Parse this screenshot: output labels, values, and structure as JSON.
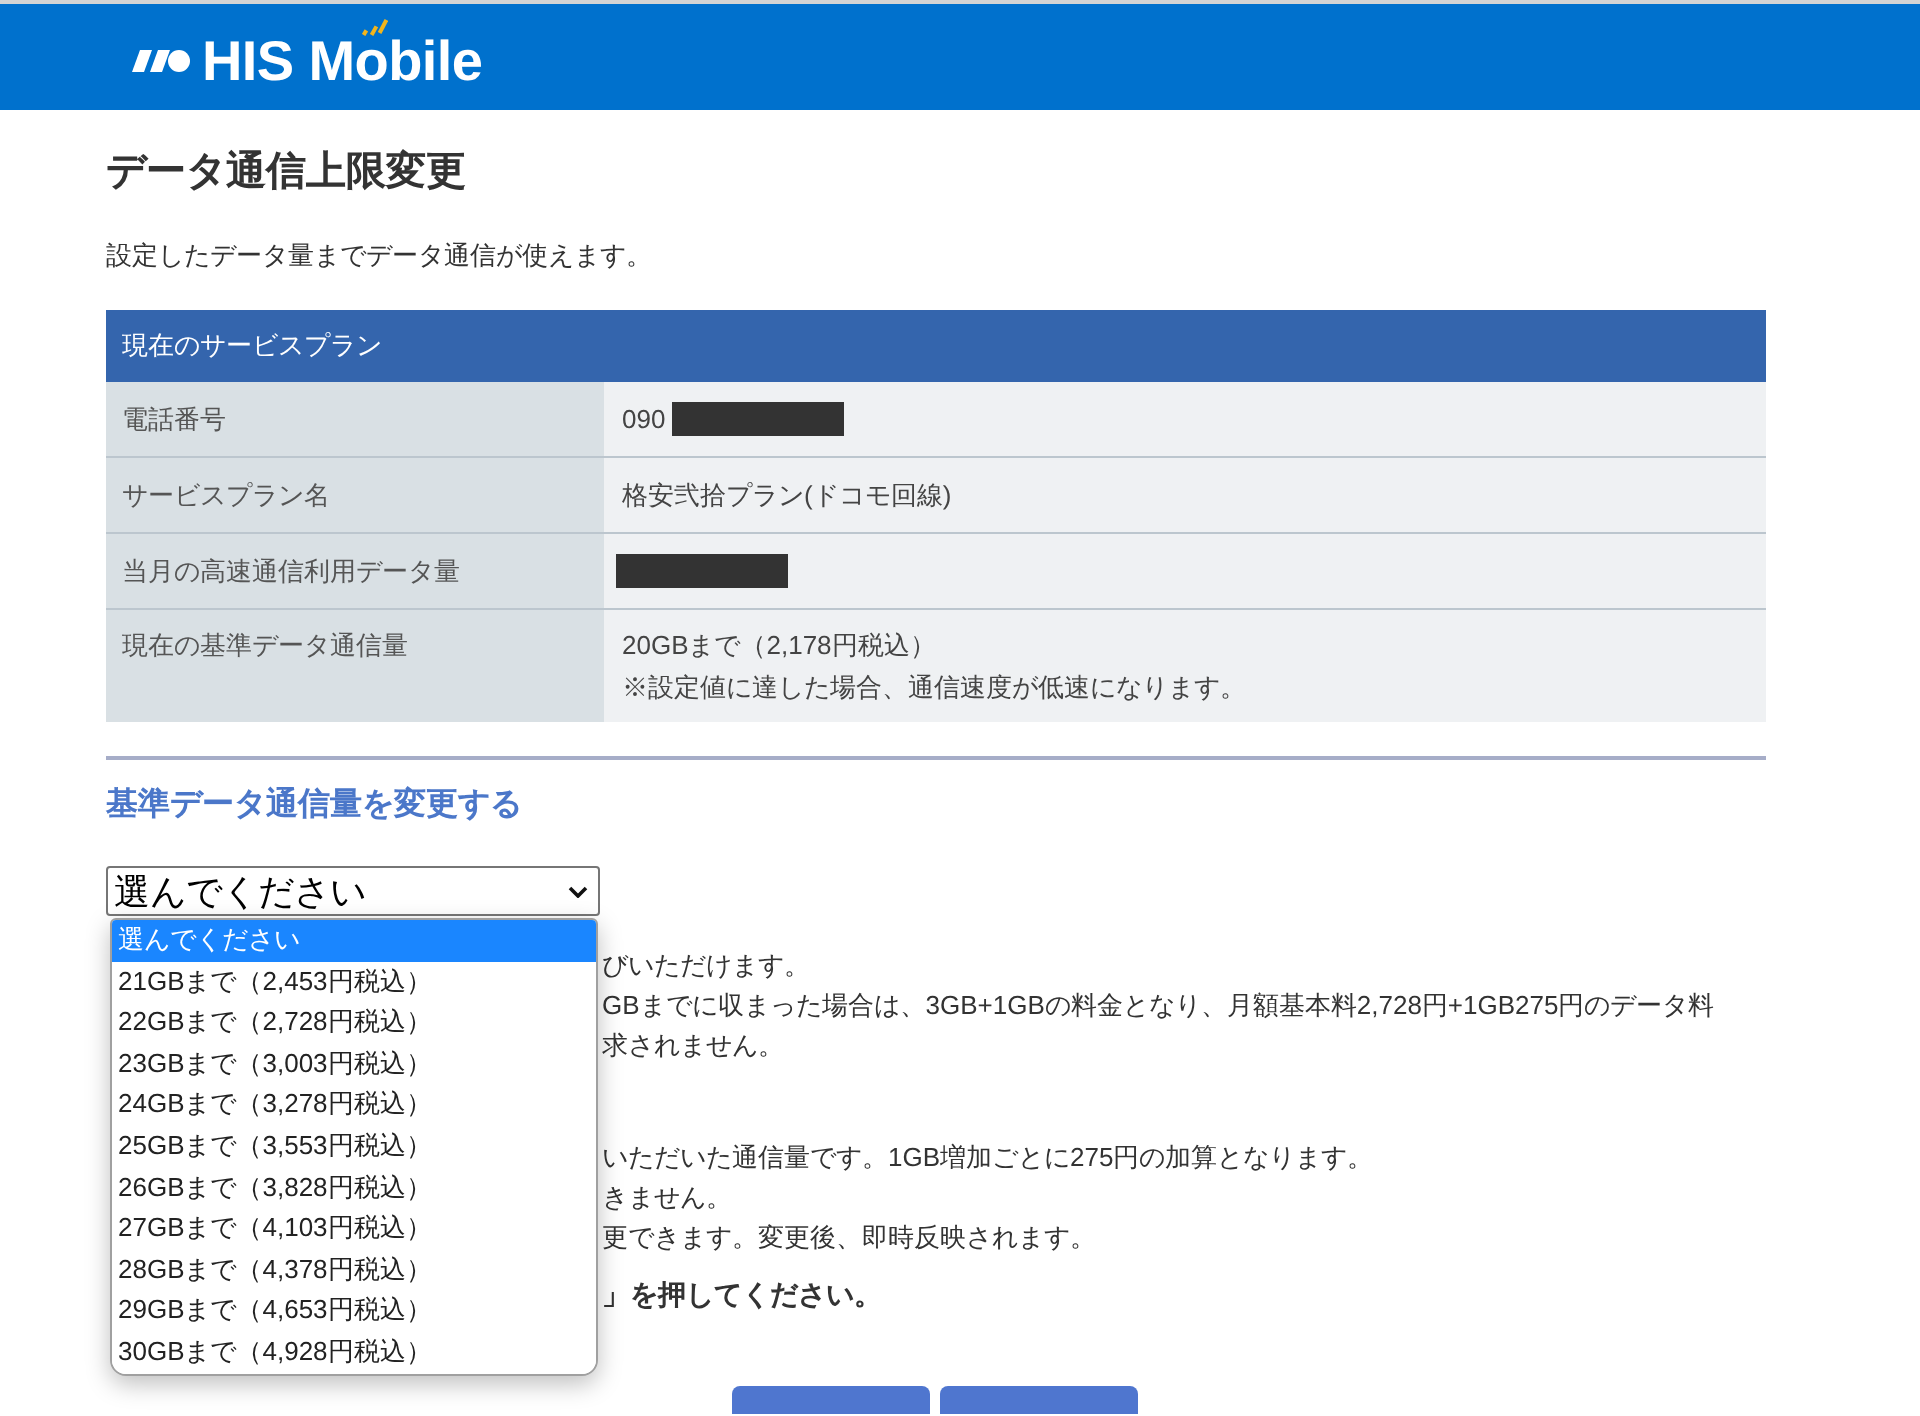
{
  "header": {
    "logo_text": "HIS Mobile"
  },
  "page": {
    "title": "データ通信上限変更",
    "description": "設定したデータ量までデータ通信が使えます。"
  },
  "plan_table": {
    "heading": "現在のサービスプラン",
    "rows": [
      {
        "label": "電話番号",
        "value_lines": [
          "090"
        ],
        "redacted": true
      },
      {
        "label": "サービスプラン名",
        "value_lines": [
          "格安弐拾プラン(ドコモ回線)"
        ],
        "redacted": false
      },
      {
        "label": "当月の高速通信利用データ量",
        "redacted": true
      },
      {
        "label": "現在の基準データ通信量",
        "value_lines": [
          "20GBまで（2,178円税込）",
          "※設定値に達した場合、通信速度が低速になります。"
        ],
        "redacted": false
      }
    ]
  },
  "change_section": {
    "heading": "基準データ通信量を変更する",
    "select": {
      "value": "選んでください",
      "expanded": true,
      "options": [
        {
          "label": "選んでください",
          "selected": true
        },
        {
          "label": "21GBまで（2,453円税込）",
          "selected": false
        },
        {
          "label": "22GBまで（2,728円税込）",
          "selected": false
        },
        {
          "label": "23GBまで（3,003円税込）",
          "selected": false
        },
        {
          "label": "24GBまで（3,278円税込）",
          "selected": false
        },
        {
          "label": "25GBまで（3,553円税込）",
          "selected": false
        },
        {
          "label": "26GBまで（3,828円税込）",
          "selected": false
        },
        {
          "label": "27GBまで（4,103円税込）",
          "selected": false
        },
        {
          "label": "28GBまで（4,378円税込）",
          "selected": false
        },
        {
          "label": "29GBまで（4,653円税込）",
          "selected": false
        },
        {
          "label": "30GBまで（4,928円税込）",
          "selected": false
        }
      ]
    },
    "note_groups": [
      {
        "lines": [
          "びいただけます。",
          "GBまでに収まった場合は、3GB+1GBの料金となり、月額基本料2,728円+1GB275円のデータ料",
          "求されません。"
        ]
      },
      {
        "lines": [
          "いただいた通信量です。1GB増加ごとに275円の加算となります。",
          "きません。",
          "更できます。変更後、即時反映されます。"
        ]
      }
    ],
    "instruction": "」を押してください。"
  }
}
